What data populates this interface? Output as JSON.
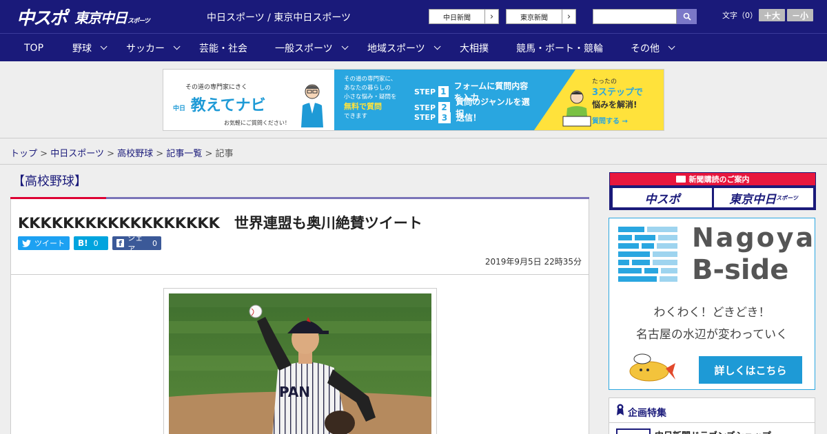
{
  "header": {
    "logo_main": "中スポ",
    "logo_sub": "東京中日",
    "logo_sub_small": "スポーツ",
    "site_title": "中日スポーツ / 東京中日スポーツ",
    "paper_links": [
      {
        "label": "中日新聞"
      },
      {
        "label": "東京新聞"
      }
    ],
    "search": {
      "value": "",
      "placeholder": ""
    },
    "font_size_label": "文字（0）",
    "font_plus": "＋大",
    "font_minus": "－小"
  },
  "nav": {
    "items": [
      {
        "label": "TOP"
      },
      {
        "label": "野球"
      },
      {
        "label": "サッカー"
      },
      {
        "label": "芸能・社会"
      },
      {
        "label": "一般スポーツ"
      },
      {
        "label": "地域スポーツ"
      },
      {
        "label": "大相撲"
      },
      {
        "label": "競馬・ボート・競輪"
      },
      {
        "label": "その他"
      }
    ]
  },
  "ad_banner": {
    "tag": "その道の専門家にきく",
    "brand_small": "中日",
    "brand": "教えてナビ",
    "note": "お気軽にご質問ください！",
    "desc_1": "その道の専門家に、",
    "desc_2": "あなたの暮らしの",
    "desc_3": "小さな悩み・疑問を",
    "desc_highlight": "無料で質問",
    "desc_4": "できます",
    "step_word": "STEP",
    "steps": [
      {
        "num": "1",
        "text": "フォームに質問内容を入力"
      },
      {
        "num": "2",
        "text": "質問のジャンルを選択"
      },
      {
        "num": "3",
        "text": "送信！"
      }
    ],
    "r1": "たったの",
    "r2": "3ステップで",
    "r3": "悩みを解消!",
    "r4": "質問する →"
  },
  "breadcrumb": {
    "items": [
      "トップ",
      "中日スポーツ",
      "高校野球",
      "記事一覧"
    ],
    "current": "記事",
    "separator": ">"
  },
  "article": {
    "category": "【高校野球】",
    "headline": "KKKKKKKKKKKKKKKKKK　世界連盟も奥川絶賛ツイート",
    "share": {
      "tweet": "ツイート",
      "hatena": "B!",
      "hatena_count": "0",
      "facebook": "シェア",
      "facebook_count": "0"
    },
    "published": "2019年9月5日 22時35分"
  },
  "sidebar": {
    "subscribe_head": "新聞購読のご案内",
    "subscribe_a": "中スポ",
    "subscribe_b": "東京中日",
    "subscribe_b_small": "スポーツ",
    "bside_line1": "Nagoya",
    "bside_line2": "B-side",
    "bside_copy1": "わくわく！どきどき！",
    "bside_copy2": "名古屋の水辺が変わっていく",
    "bside_button": "詳しくはこちら",
    "feature_title": "企画特集",
    "feature_item": "中日新聞ドラゴンズショップ"
  },
  "colors": {
    "header_bg": "#1a1a7a",
    "accent_red": "#e8173d",
    "twitter": "#1da1f2",
    "hatena": "#00a4de",
    "facebook": "#3b5998",
    "bside_blue": "#1e9ad6"
  }
}
